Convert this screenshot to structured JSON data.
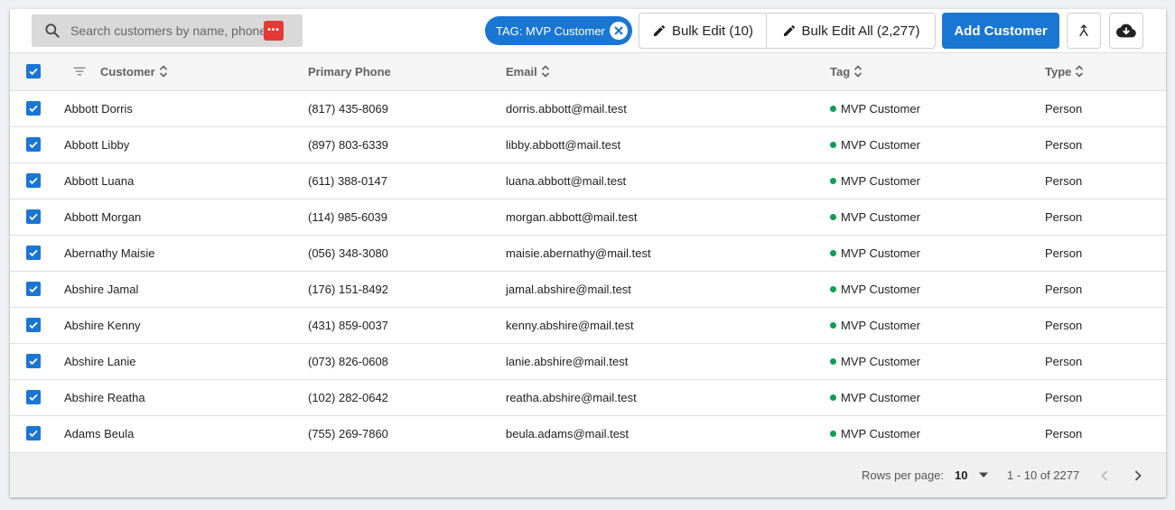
{
  "search": {
    "placeholder": "Search customers by name, phone or email"
  },
  "filter_chip": {
    "label": "TAG: MVP Customer"
  },
  "toolbar": {
    "bulk_edit_label": "Bulk Edit (10)",
    "bulk_edit_all_label": "Bulk Edit All (2,277)",
    "add_customer_label": "Add Customer",
    "merge_icon": "merge-icon",
    "download_icon": "cloud-download-icon"
  },
  "table": {
    "headers": {
      "customer": "Customer",
      "phone": "Primary Phone",
      "email": "Email",
      "tag": "Tag",
      "type": "Type"
    },
    "rows": [
      {
        "name": "Abbott Dorris",
        "phone": "(817) 435-8069",
        "email": "dorris.abbott@mail.test",
        "tag": "MVP Customer",
        "type": "Person"
      },
      {
        "name": "Abbott Libby",
        "phone": "(897) 803-6339",
        "email": "libby.abbott@mail.test",
        "tag": "MVP Customer",
        "type": "Person"
      },
      {
        "name": "Abbott Luana",
        "phone": "(611) 388-0147",
        "email": "luana.abbott@mail.test",
        "tag": "MVP Customer",
        "type": "Person"
      },
      {
        "name": "Abbott Morgan",
        "phone": "(114) 985-6039",
        "email": "morgan.abbott@mail.test",
        "tag": "MVP Customer",
        "type": "Person"
      },
      {
        "name": "Abernathy Maisie",
        "phone": "(056) 348-3080",
        "email": "maisie.abernathy@mail.test",
        "tag": "MVP Customer",
        "type": "Person"
      },
      {
        "name": "Abshire Jamal",
        "phone": "(176) 151-8492",
        "email": "jamal.abshire@mail.test",
        "tag": "MVP Customer",
        "type": "Person"
      },
      {
        "name": "Abshire Kenny",
        "phone": "(431) 859-0037",
        "email": "kenny.abshire@mail.test",
        "tag": "MVP Customer",
        "type": "Person"
      },
      {
        "name": "Abshire Lanie",
        "phone": "(073) 826-0608",
        "email": "lanie.abshire@mail.test",
        "tag": "MVP Customer",
        "type": "Person"
      },
      {
        "name": "Abshire Reatha",
        "phone": "(102) 282-0642",
        "email": "reatha.abshire@mail.test",
        "tag": "MVP Customer",
        "type": "Person"
      },
      {
        "name": "Adams Beula",
        "phone": "(755) 269-7860",
        "email": "beula.adams@mail.test",
        "tag": "MVP Customer",
        "type": "Person"
      }
    ]
  },
  "pagination": {
    "rows_per_page_label": "Rows per page:",
    "rows_per_page_value": "10",
    "range_label": "1 - 10 of 2277"
  },
  "colors": {
    "accent": "#1976d2",
    "tag_dot": "#0f9d58",
    "password_badge": "#e53935"
  }
}
